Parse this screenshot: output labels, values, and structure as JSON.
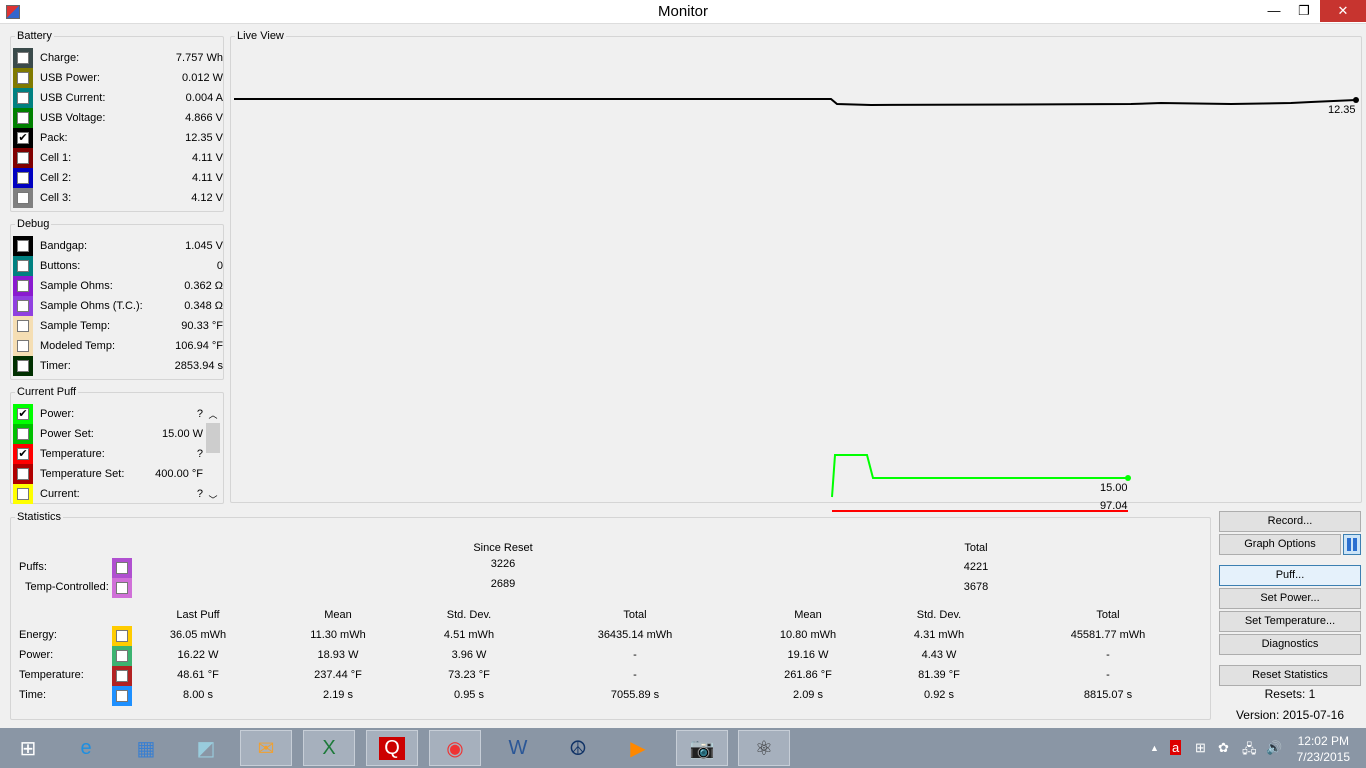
{
  "window": {
    "title": "Monitor"
  },
  "battery": {
    "title": "Battery",
    "items": [
      {
        "label": "Charge:",
        "value": "7.757 Wh",
        "color": "#3a4a4a",
        "checked": false
      },
      {
        "label": "USB Power:",
        "value": "0.012 W",
        "color": "#807a00",
        "checked": false
      },
      {
        "label": "USB Current:",
        "value": "0.004 A",
        "color": "#008080",
        "checked": false
      },
      {
        "label": "USB Voltage:",
        "value": "4.866 V",
        "color": "#008000",
        "checked": false
      },
      {
        "label": "Pack:",
        "value": "12.35 V",
        "color": "#000000",
        "checked": true
      },
      {
        "label": "Cell 1:",
        "value": "4.11 V",
        "color": "#800000",
        "checked": false
      },
      {
        "label": "Cell 2:",
        "value": "4.11 V",
        "color": "#0000c0",
        "checked": false
      },
      {
        "label": "Cell 3:",
        "value": "4.12 V",
        "color": "#808080",
        "checked": false
      }
    ]
  },
  "debug": {
    "title": "Debug",
    "items": [
      {
        "label": "Bandgap:",
        "value": "1.045 V",
        "color": "#000000",
        "checked": false
      },
      {
        "label": "Buttons:",
        "value": "0",
        "color": "#008080",
        "checked": false
      },
      {
        "label": "Sample Ohms:",
        "value": "0.362 Ω",
        "color": "#8a1ad0",
        "checked": false
      },
      {
        "label": "Sample Ohms (T.C.):",
        "value": "0.348 Ω",
        "color": "#9040e0",
        "checked": false
      },
      {
        "label": "Sample Temp:",
        "value": "90.33 °F",
        "color": "#f5deb3",
        "checked": false
      },
      {
        "label": "Modeled Temp:",
        "value": "106.94 °F",
        "color": "#f5deb3",
        "checked": false
      },
      {
        "label": "Timer:",
        "value": "2853.94 s",
        "color": "#003000",
        "checked": false
      }
    ]
  },
  "current_puff": {
    "title": "Current Puff",
    "items": [
      {
        "label": "Power:",
        "value": "?",
        "color": "#00ff00",
        "checked": true
      },
      {
        "label": "Power Set:",
        "value": "15.00 W",
        "color": "#00c000",
        "checked": false
      },
      {
        "label": "Temperature:",
        "value": "?",
        "color": "#ff0000",
        "checked": true
      },
      {
        "label": "Temperature Set:",
        "value": "400.00 °F",
        "color": "#b00000",
        "checked": false
      },
      {
        "label": "Current:",
        "value": "?",
        "color": "#ffff00",
        "checked": false
      }
    ]
  },
  "live_view": {
    "title": "Live View",
    "series": [
      {
        "name": "Pack",
        "label": "12.35",
        "color": "#000000"
      },
      {
        "name": "Power",
        "label": "15.00",
        "color": "#00ff00"
      },
      {
        "name": "Temperature",
        "label": "97.04",
        "color": "#ff0000"
      }
    ]
  },
  "statistics": {
    "title": "Statistics",
    "since_reset": "Since Reset",
    "total": "Total",
    "puffs": {
      "label": "Puffs:",
      "since": "3226",
      "total": "4221",
      "color": "#b050d0"
    },
    "temp_controlled": {
      "label": "Temp-Controlled:",
      "since": "2689",
      "total": "3678",
      "color": "#d070d8"
    },
    "columns": [
      "Last Puff",
      "Mean",
      "Std. Dev.",
      "Total",
      "Mean",
      "Std. Dev.",
      "Total"
    ],
    "rows": [
      {
        "label": "Energy:",
        "color": "#ffcc00",
        "values": [
          "36.05 mWh",
          "11.30 mWh",
          "4.51 mWh",
          "36435.14 mWh",
          "10.80 mWh",
          "4.31 mWh",
          "45581.77 mWh"
        ]
      },
      {
        "label": "Power:",
        "color": "#3cb371",
        "values": [
          "16.22 W",
          "18.93 W",
          "3.96 W",
          "-",
          "19.16 W",
          "4.43 W",
          "-"
        ]
      },
      {
        "label": "Temperature:",
        "color": "#b22222",
        "values": [
          "48.61 °F",
          "237.44 °F",
          "73.23 °F",
          "-",
          "261.86 °F",
          "81.39 °F",
          "-"
        ]
      },
      {
        "label": "Time:",
        "color": "#1e90ff",
        "values": [
          "8.00 s",
          "2.19 s",
          "0.95 s",
          "7055.89 s",
          "2.09 s",
          "0.92 s",
          "8815.07 s"
        ]
      }
    ]
  },
  "buttons": {
    "record": "Record...",
    "graph_options": "Graph Options",
    "puff": "Puff...",
    "set_power": "Set Power...",
    "set_temperature": "Set Temperature...",
    "diagnostics": "Diagnostics",
    "reset_statistics": "Reset Statistics"
  },
  "resets": "Resets: 1",
  "version": "Version: 2015-07-16",
  "taskbar": {
    "apps": [
      "start",
      "internet-explorer",
      "calculator",
      "notes",
      "outlook",
      "excel",
      "quicktime",
      "chrome",
      "word",
      "network-app",
      "media-player",
      "camera-app",
      "monitor-app"
    ],
    "time": "12:02 PM",
    "date": "7/23/2015"
  }
}
